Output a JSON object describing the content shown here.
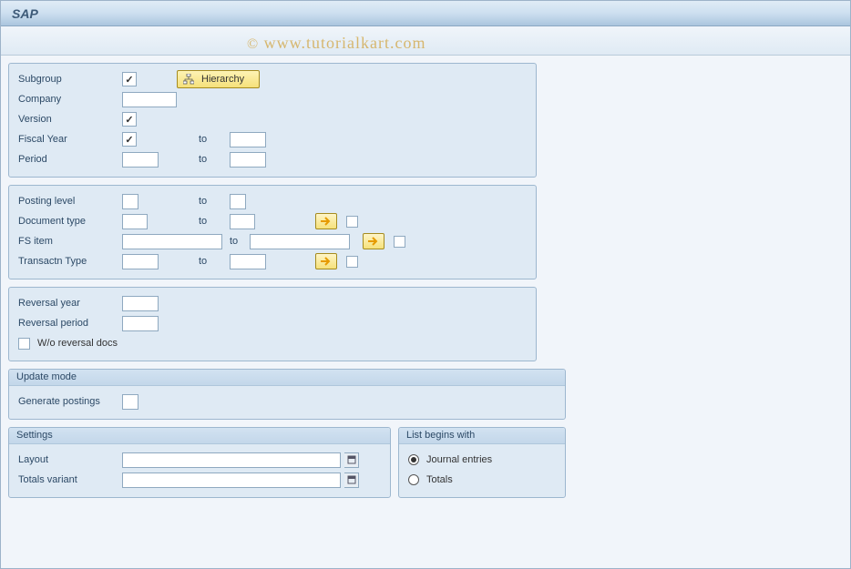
{
  "title": "SAP",
  "watermark": "www.tutorialkart.com",
  "group1": {
    "subgroup_label": "Subgroup",
    "company_label": "Company",
    "version_label": "Version",
    "fiscalyear_label": "Fiscal Year",
    "period_label": "Period",
    "to_label1": "to",
    "to_label2": "to",
    "hierarchy_btn": "Hierarchy"
  },
  "group2": {
    "postinglevel_label": "Posting level",
    "doctype_label": "Document type",
    "fsitem_label": "FS item",
    "transtype_label": "Transactn Type",
    "to1": "to",
    "to2": "to",
    "to3": "to",
    "to4": "to"
  },
  "group3": {
    "revyear_label": "Reversal year",
    "revperiod_label": "Reversal period",
    "wodocs_label": "W/o reversal docs"
  },
  "group4": {
    "title": "Update mode",
    "genpost_label": "Generate postings"
  },
  "settings": {
    "title": "Settings",
    "layout_label": "Layout",
    "totalsvar_label": "Totals variant"
  },
  "listbegins": {
    "title": "List begins with",
    "opt1": "Journal entries",
    "opt2": "Totals"
  }
}
